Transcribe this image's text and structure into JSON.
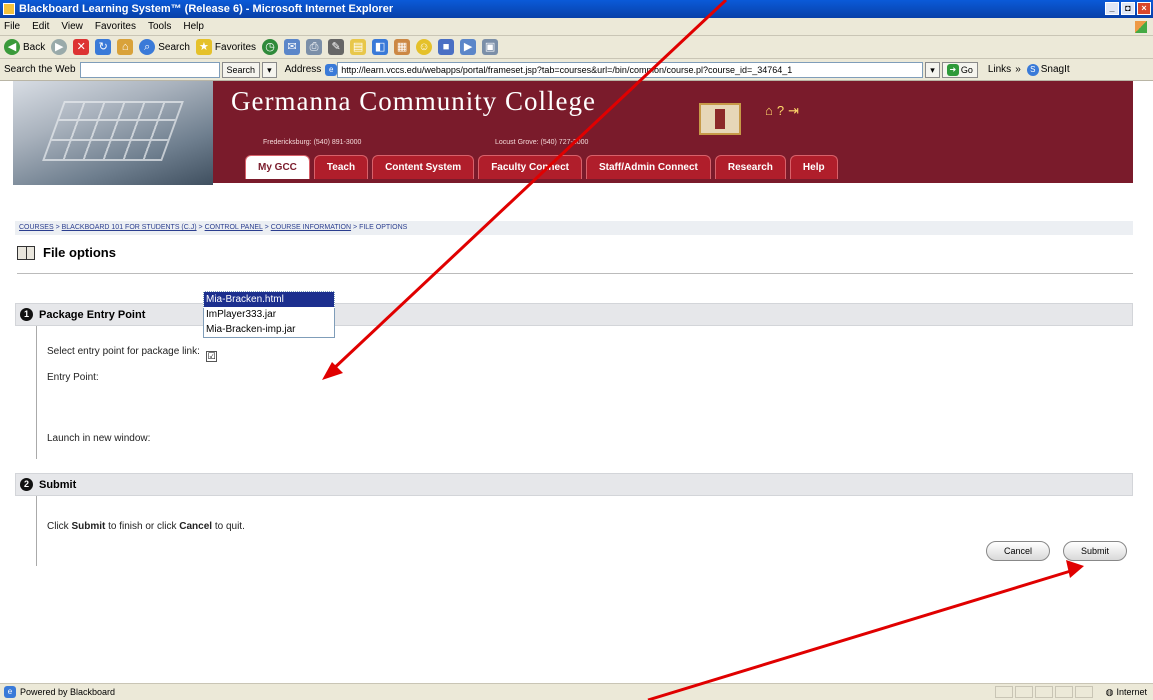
{
  "window": {
    "title": "Blackboard Learning System™ (Release 6) - Microsoft Internet Explorer",
    "minimize": "_",
    "maximize": "◘",
    "close": "×"
  },
  "menu": [
    "File",
    "Edit",
    "View",
    "Favorites",
    "Tools",
    "Help"
  ],
  "toolbar": {
    "back": "Back",
    "search": "Search",
    "favorites": "Favorites"
  },
  "addressbar": {
    "search_label": "Search the Web",
    "search_button": "Search",
    "address_label": "Address",
    "url": "http://learn.vccs.edu/webapps/portal/frameset.jsp?tab=courses&url=/bin/common/course.pl?course_id=_34764_1",
    "go": "Go",
    "links": "Links",
    "snagit": "SnagIt"
  },
  "banner": {
    "college_name": "Germanna Community College",
    "campus_1": "Fredericksburg: (540) 891-3000",
    "campus_2": "Locust Grove: (540) 727-3000",
    "tabs": [
      "My GCC",
      "Teach",
      "Content System",
      "Faculty Connect",
      "Staff/Admin Connect",
      "Research",
      "Help"
    ]
  },
  "breadcrumb": {
    "courses": "COURSES",
    "course": "BLACKBOARD 101 FOR STUDENTS (C.J)",
    "control_panel": "CONTROL PANEL",
    "course_info": "COURSE INFORMATION",
    "current": "FILE OPTIONS",
    "sep": ">"
  },
  "page": {
    "title": "File options"
  },
  "section1": {
    "number": "1",
    "heading": "Package Entry Point",
    "instruction": "Select entry point for package link:",
    "entry_label": "Entry Point:",
    "options": [
      "Mia-Bracken.html",
      "ImPlayer333.jar",
      "Mia-Bracken-imp.jar"
    ],
    "selected": "Mia-Bracken.html",
    "launch_label": "Launch in new window:",
    "launch_checked": "☑"
  },
  "section2": {
    "number": "2",
    "heading": "Submit",
    "text_pre": "Click ",
    "text_submit": "Submit",
    "text_mid": " to finish or click ",
    "text_cancel": "Cancel",
    "text_post": " to quit."
  },
  "buttons": {
    "cancel": "Cancel",
    "submit": "Submit"
  },
  "status": {
    "left": "Powered by Blackboard",
    "zone": "Internet"
  },
  "annotation_color": "#e00000"
}
